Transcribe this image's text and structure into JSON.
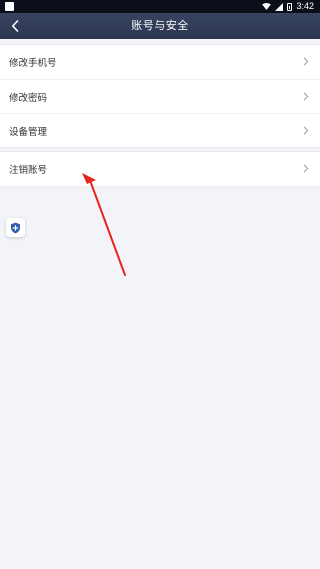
{
  "status_bar": {
    "time": "3:42"
  },
  "nav": {
    "title": "账号与安全",
    "back_icon": "chevron-left-icon"
  },
  "groups": [
    {
      "items": [
        {
          "label": "修改手机号"
        },
        {
          "label": "修改密码"
        },
        {
          "label": "设备管理"
        }
      ]
    },
    {
      "items": [
        {
          "label": "注销账号"
        }
      ]
    }
  ],
  "colors": {
    "nav_bg": "#2f3a56",
    "page_bg": "#f3f4f7",
    "annotation": "#e8231b",
    "shield": "#2f5fb3"
  }
}
